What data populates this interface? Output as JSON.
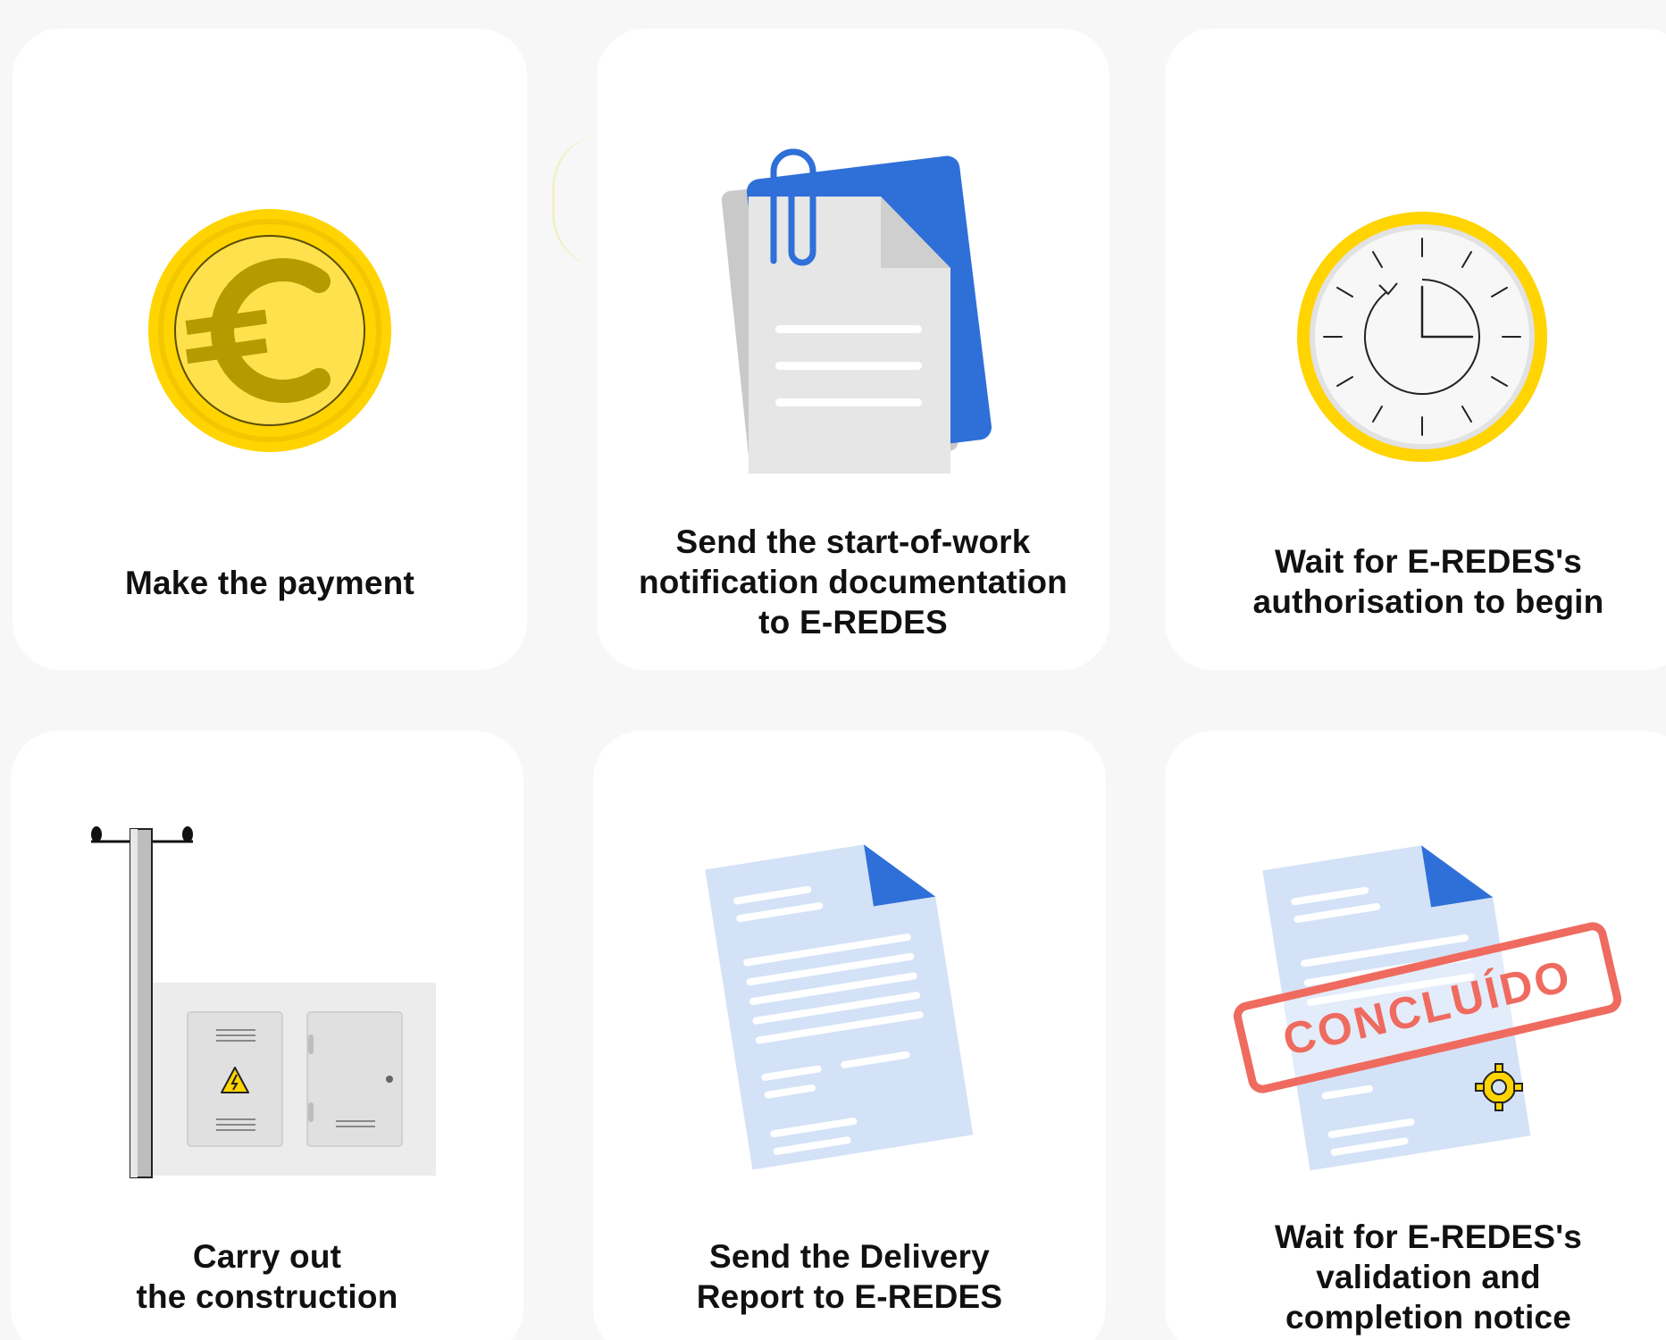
{
  "steps": [
    {
      "label": "Make the payment",
      "icon": "euro-coin-icon"
    },
    {
      "label": "Send the start-of-work\nnotification documentation\nto E-REDES",
      "icon": "paperclip-documents-icon"
    },
    {
      "label": "Wait for E-REDES's\nauthorisation to begin",
      "icon": "clock-icon"
    },
    {
      "label": "Carry out\nthe construction",
      "icon": "utility-pole-meter-box-icon"
    },
    {
      "label": "Send the Delivery\nReport to E-REDES",
      "icon": "report-document-icon"
    },
    {
      "label": "Wait for E-REDES's\nvalidation and\ncompletion notice",
      "icon": "completed-stamp-document-icon"
    }
  ],
  "stamp": {
    "text": "CONCLUÍDO"
  },
  "colors": {
    "coin_gold": "#ffd400",
    "coin_dark": "#b59a00",
    "blue": "#2f6fd8",
    "doc_light_blue": "#d4e2f7",
    "stamp_red": "#ef6b5f",
    "paper_grey": "#e4e4e4"
  }
}
